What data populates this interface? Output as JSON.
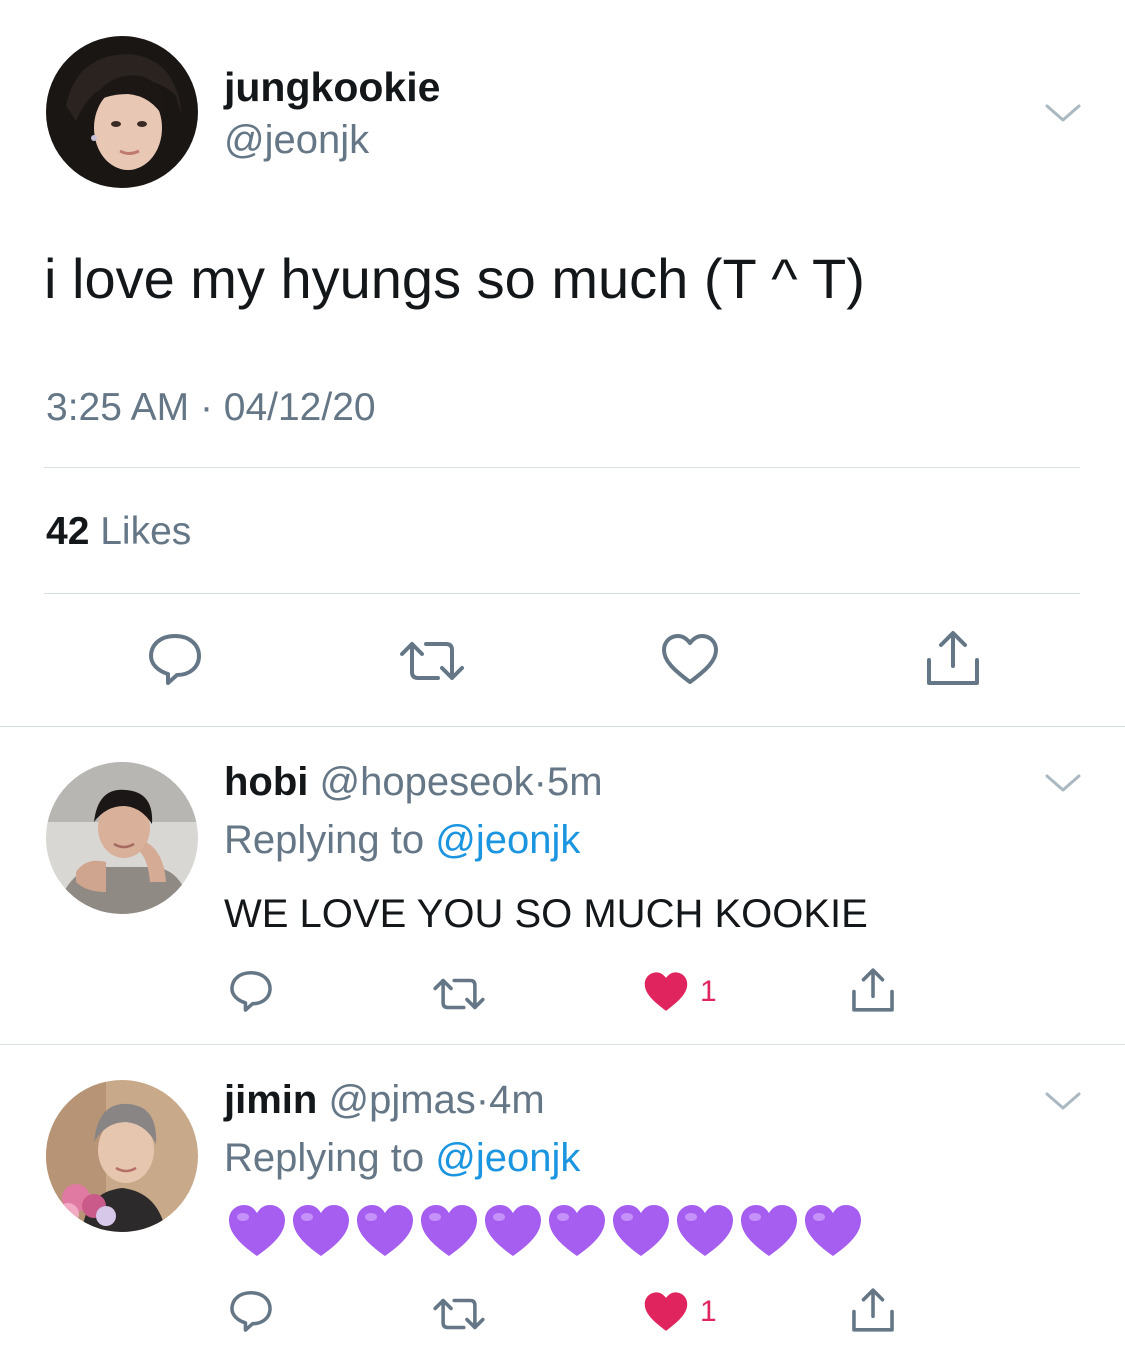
{
  "main_tweet": {
    "display_name": "jungkookie",
    "handle": "@jeonjk",
    "text": "i love my hyungs so much (T ^ T)",
    "time": "3:25 AM",
    "separator": "·",
    "date": "04/12/20",
    "likes_count": "42",
    "likes_label": "Likes",
    "avatar": "avatar-photo"
  },
  "replies": [
    {
      "display_name": "hobi",
      "handle": "@hopeseok",
      "separator": "·",
      "age": "5m",
      "replying_label": "Replying to",
      "replying_to": "@jeonjk",
      "text": "WE LOVE YOU SO MUCH KOOKIE",
      "like_count": "1",
      "liked": true
    },
    {
      "display_name": "jimin",
      "handle": "@pjmas",
      "separator": "·",
      "age": "4m",
      "replying_label": "Replying to",
      "replying_to": "@jeonjk",
      "text_emoji": "purple-heart",
      "emoji_count": 10,
      "like_count": "1",
      "liked": true
    }
  ],
  "colors": {
    "text_primary": "#14171a",
    "text_secondary": "#657786",
    "link": "#1b95e0",
    "like_red": "#e0245e",
    "purple_heart": "#a55ef0",
    "divider": "#d8dfe4"
  }
}
